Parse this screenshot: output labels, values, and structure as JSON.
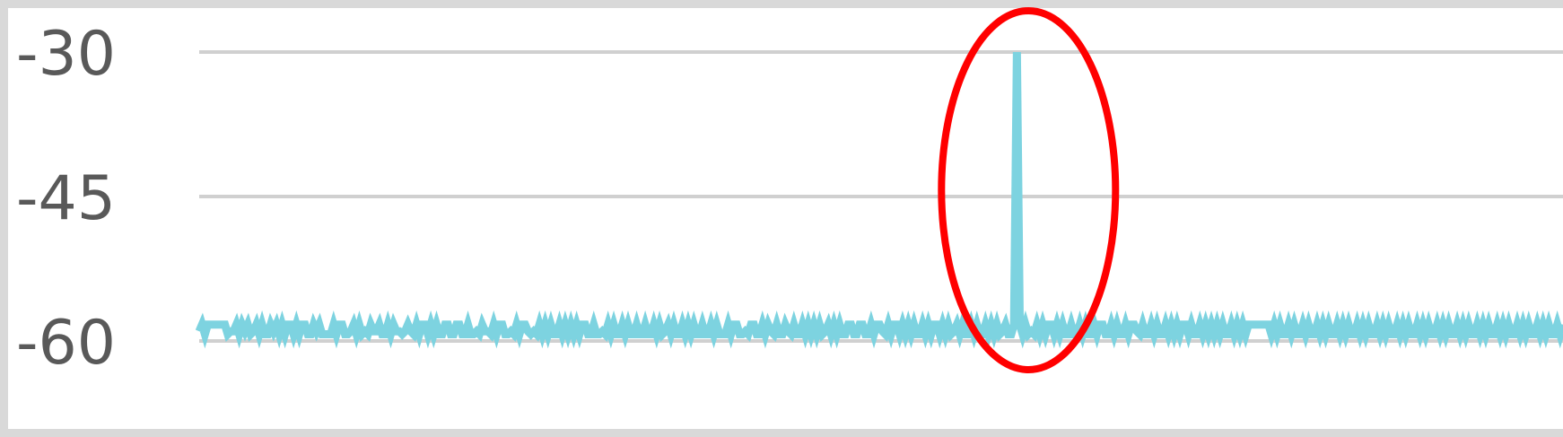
{
  "chart_data": {
    "type": "line",
    "title": "",
    "xlabel": "",
    "ylabel": "",
    "ylim": [
      -60,
      -30
    ],
    "y_ticks": [
      -30,
      -45,
      -60
    ],
    "y_tick_labels": [
      "-30",
      "-45",
      "-60"
    ],
    "grid": true,
    "legend": "none",
    "spike_index": 291,
    "series": [
      {
        "color": "#7dd3e0",
        "values": [
          -59,
          -58.3,
          -59.3,
          -58.3,
          -58.3,
          -58.3,
          -58.3,
          -58.3,
          -58.3,
          -58.3,
          -59.3,
          -59,
          -59,
          -58.3,
          -59.3,
          -58.3,
          -59,
          -58.3,
          -59.3,
          -59,
          -58.3,
          -59.3,
          -58.3,
          -59.3,
          -59.3,
          -58.3,
          -59,
          -58.3,
          -59.3,
          -58.3,
          -59.3,
          -58.3,
          -58.3,
          -59.3,
          -58.3,
          -59.3,
          -58.3,
          -58.3,
          -59.3,
          -59.3,
          -58.3,
          -59,
          -58.3,
          -59.3,
          -59.3,
          -59.3,
          -59.3,
          -58.3,
          -59.3,
          -58.3,
          -58.3,
          -59.3,
          -59.3,
          -59,
          -58.3,
          -59.3,
          -58.3,
          -59.3,
          -59,
          -59.3,
          -58.3,
          -59,
          -59,
          -58.3,
          -59.3,
          -59.3,
          -58.3,
          -59.3,
          -58.3,
          -59,
          -59,
          -59.3,
          -59,
          -58.3,
          -59,
          -59.3,
          -58.3,
          -59.3,
          -58.3,
          -58.3,
          -59.3,
          -58.3,
          -59.3,
          -58.3,
          -59.3,
          -59.3,
          -58.3,
          -58.3,
          -59.3,
          -59.3,
          -58.3,
          -58.3,
          -59.3,
          -59.3,
          -58.3,
          -59.3,
          -59.3,
          -59,
          -59.3,
          -58.3,
          -59,
          -59,
          -59.3,
          -58.3,
          -59.3,
          -58.3,
          -58.3,
          -59.3,
          -59.3,
          -59,
          -59.3,
          -58.3,
          -59.3,
          -58.3,
          -58.3,
          -59,
          -59.3,
          -59,
          -59.3,
          -58.3,
          -59.3,
          -58.3,
          -59.3,
          -58.3,
          -59.3,
          -59.3,
          -58.3,
          -59.3,
          -58.3,
          -59.3,
          -58.3,
          -59.3,
          -58.3,
          -59.3,
          -58.3,
          -58.3,
          -59.3,
          -59.3,
          -58.3,
          -59.3,
          -59.3,
          -59,
          -59.3,
          -58.3,
          -59.3,
          -58.3,
          -59.3,
          -59.3,
          -58.3,
          -59.3,
          -58.3,
          -59.3,
          -59.3,
          -58.3,
          -59.3,
          -59.3,
          -58.3,
          -59.3,
          -59.3,
          -58.3,
          -59.3,
          -58.3,
          -59.3,
          -59,
          -58.3,
          -59.3,
          -58.3,
          -59.3,
          -59.3,
          -58.3,
          -59.3,
          -58.3,
          -59.3,
          -58.3,
          -59.3,
          -59.3,
          -58.3,
          -59.3,
          -59.3,
          -58.3,
          -59.3,
          -58.3,
          -59.3,
          -59.3,
          -59.3,
          -58.3,
          -59.3,
          -58.3,
          -58.3,
          -59.3,
          -59.3,
          -59,
          -59.3,
          -58.3,
          -58.3,
          -59.3,
          -59.3,
          -58.3,
          -59.3,
          -58.3,
          -59,
          -59.3,
          -58.3,
          -59.3,
          -59.3,
          -58.3,
          -59,
          -59.3,
          -58.3,
          -59.3,
          -59.3,
          -58.3,
          -59.3,
          -58.3,
          -59.3,
          -58.3,
          -59.3,
          -58.3,
          -59.3,
          -59,
          -58.3,
          -59.3,
          -58.3,
          -59.3,
          -58.3,
          -59.3,
          -59.3,
          -58.3,
          -58.3,
          -59.3,
          -59.3,
          -58.3,
          -58.3,
          -59.3,
          -59.3,
          -58.3,
          -59.3,
          -58.3,
          -58.3,
          -59,
          -59.3,
          -58.3,
          -59.3,
          -58.3,
          -58.3,
          -59.3,
          -58.3,
          -59.3,
          -58.3,
          -59.3,
          -58.3,
          -59.3,
          -59.3,
          -58.3,
          -59.3,
          -58.3,
          -59.3,
          -58.3,
          -58.3,
          -59.3,
          -58.3,
          -59.3,
          -58.3,
          -59.3,
          -59,
          -58.3,
          -59.3,
          -58.3,
          -59.3,
          -59.3,
          -58.3,
          -59.3,
          -58.3,
          -59.3,
          -59.3,
          -58.3,
          -59.3,
          -58.3,
          -59.3,
          -58.3,
          -59.3,
          -59,
          -58.3,
          -59.3,
          -59.3,
          -58.3,
          -30,
          -58.3,
          -59.3,
          -58.3,
          -59.3,
          -59,
          -59.3,
          -58.3,
          -59.3,
          -58.3,
          -59.3,
          -58.3,
          -58.3,
          -59.3,
          -58.3,
          -59.3,
          -58.3,
          -59.3,
          -59.3,
          -58.3,
          -59.3,
          -59.3,
          -58.3,
          -59.3,
          -58.3,
          -59.3,
          -59.3,
          -58.3,
          -59.3,
          -58.3,
          -58.3,
          -59.3,
          -59.3,
          -58.3,
          -59.3,
          -58.3,
          -59.3,
          -59.3,
          -58.3,
          -59.3,
          -58.3,
          -58.3,
          -59,
          -59.3,
          -58.3,
          -59.3,
          -59.3,
          -58.3,
          -59.3,
          -58.3,
          -59.3,
          -59.3,
          -58.3,
          -59.3,
          -58.3,
          -59.3,
          -58.3,
          -59.3,
          -58.3,
          -58.3,
          -59.3,
          -58.3,
          -59.3,
          -59.3,
          -58.3,
          -59.3,
          -58.3,
          -59.3,
          -58.3,
          -59.3,
          -58.3,
          -59.3,
          -58.3,
          -59.3,
          -59.3,
          -58.3,
          -59.3,
          -58.3,
          -59.3,
          -58.3,
          -59.3,
          -58.3,
          -58.3,
          -58.3,
          -58.3,
          -58.3,
          -58.3,
          -58.3,
          -58.3,
          -59.3,
          -58.3,
          -59.3,
          -58.3,
          -59.3,
          -59.3,
          -58.3,
          -59.3,
          -58.3,
          -59.3,
          -59.3,
          -58.3,
          -59.3,
          -58.3,
          -59.3,
          -59.3,
          -58.3,
          -59.3,
          -58.3,
          -59.3,
          -58.3,
          -59.3,
          -59.3,
          -58.3,
          -59.3,
          -58.3,
          -59.3,
          -58.3,
          -59.3,
          -59.3,
          -58.3,
          -59.3,
          -58.3,
          -59.3,
          -58.3,
          -59.3,
          -59.3,
          -58.3,
          -59.3,
          -58.3,
          -59.3,
          -58.3,
          -59.3,
          -59.3,
          -58.3,
          -59.3,
          -58.3,
          -59.3,
          -58.3,
          -59.3,
          -59.3,
          -58.3,
          -59.3,
          -58.3,
          -59.3,
          -58.3,
          -59.3,
          -59.3,
          -58.3,
          -59.3,
          -58.3,
          -59.3,
          -58.3,
          -59.3,
          -59.3,
          -58.3,
          -59.3,
          -58.3,
          -59.3,
          -58.3,
          -59.3,
          -59.3,
          -58.3,
          -59.3,
          -58.3,
          -59.3,
          -58.3,
          -59.3,
          -59.3,
          -58.3,
          -59.3,
          -58.3,
          -59.3,
          -58.3,
          -59.3,
          -59.3,
          -58.3,
          -59.3,
          -58.3,
          -59.3,
          -58.3,
          -59.3,
          -59.3,
          -58.3,
          -59.3,
          -58.3,
          -59.3,
          -58.3,
          -59.3,
          -59.3,
          -58.3,
          -59.3,
          -58.3
        ]
      }
    ]
  },
  "annotation": {
    "shape": "ellipse",
    "color": "#ff0000"
  }
}
